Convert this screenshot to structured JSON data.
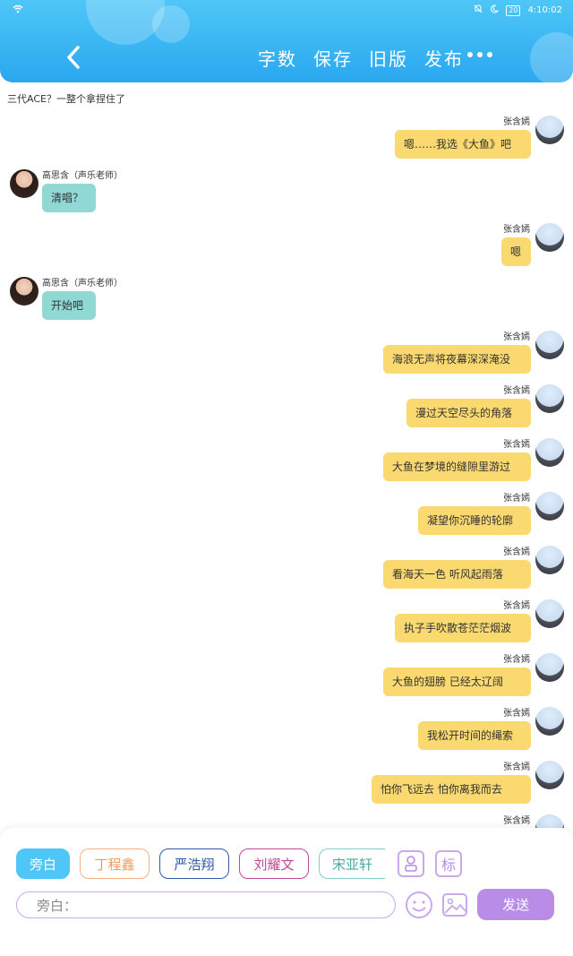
{
  "status_bar": {
    "battery": "20",
    "time": "4:10:02"
  },
  "header": {
    "actions": [
      "字数",
      "保存",
      "旧版",
      "发布"
    ]
  },
  "colors": {
    "header": "#2aa8f0",
    "bubble_right": "#fbd971",
    "bubble_left": "#8fd8d3",
    "accent_purple": "#b98ce8"
  },
  "chat": {
    "narration": "三代ACE？一整个拿捏住了",
    "messages": [
      {
        "side": "right",
        "name": "张含嫣",
        "text": "嗯……我选《大鱼》吧"
      },
      {
        "side": "left",
        "name": "高思含（声乐老师）",
        "text": "清唱？"
      },
      {
        "side": "right",
        "name": "张含嫣",
        "text": "嗯"
      },
      {
        "side": "left",
        "name": "高思含（声乐老师）",
        "text": "开始吧"
      },
      {
        "side": "right",
        "name": "张含嫣",
        "text": "海浪无声将夜幕深深淹没"
      },
      {
        "side": "right",
        "name": "张含嫣",
        "text": "漫过天空尽头的角落"
      },
      {
        "side": "right",
        "name": "张含嫣",
        "text": "大鱼在梦境的缝隙里游过"
      },
      {
        "side": "right",
        "name": "张含嫣",
        "text": "凝望你沉睡的轮廓"
      },
      {
        "side": "right",
        "name": "张含嫣",
        "text": "看海天一色 听风起雨落"
      },
      {
        "side": "right",
        "name": "张含嫣",
        "text": "执子手吹散苍茫茫烟波"
      },
      {
        "side": "right",
        "name": "张含嫣",
        "text": "大鱼的翅膀 已经太辽阔"
      },
      {
        "side": "right",
        "name": "张含嫣",
        "text": "我松开时间的绳索"
      },
      {
        "side": "right",
        "name": "张含嫣",
        "text": "怕你飞远去 怕你离我而去"
      },
      {
        "side": "right",
        "name": "张含嫣",
        "text": ""
      }
    ]
  },
  "panel": {
    "chips": [
      "旁白",
      "丁程鑫",
      "严浩翔",
      "刘耀文",
      "宋亚轩"
    ],
    "icons": [
      "person-icon",
      "tag-icon"
    ],
    "tag_label": "标",
    "input_placeholder": "旁白：",
    "send_label": "发送"
  }
}
